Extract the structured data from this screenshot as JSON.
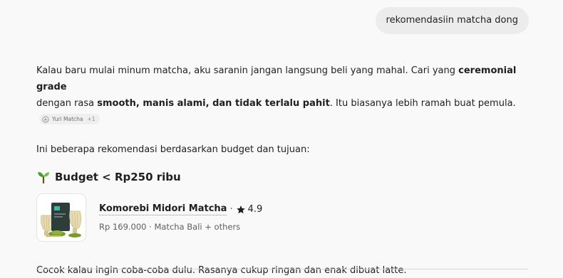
{
  "user_message": "rekomendasiin matcha dong",
  "answer": {
    "p1_part1": "Kalau baru mulai minum matcha, aku saranin jangan langsung beli yang mahal. Cari yang ",
    "p1_bold1": "ceremonial grade",
    "p1_part2": " dengan rasa ",
    "p1_bold2": "smooth, manis alami, dan tidak terlalu pahit",
    "p1_part3": ". Itu biasanya lebih ramah buat pemula.",
    "source_chip": {
      "icon": "matcha-logo-icon",
      "label": "Yuri Matcha",
      "extra": "+1"
    },
    "intro": "Ini beberapa rekomendasi berdasarkan budget dan tujuan:",
    "section_heading": "Budget < Rp250 ribu",
    "section_icon": "seedling-icon",
    "product": {
      "name": "Komorebi Midori Matcha",
      "separator": "·",
      "rating": "4.9",
      "rating_icon": "star-icon",
      "meta": "Rp 169.000 · Matcha Bali + others"
    },
    "closing": "Cocok kalau ingin coba-coba dulu. Rasanya cukup ringan dan enak dibuat latte."
  },
  "colors": {
    "background": "#f9f9f9",
    "bubble": "#ececec",
    "matcha_green": "#7a9a2e",
    "pouch_dark": "#2e3c3a",
    "pouch_teal": "#3fb8a8"
  }
}
